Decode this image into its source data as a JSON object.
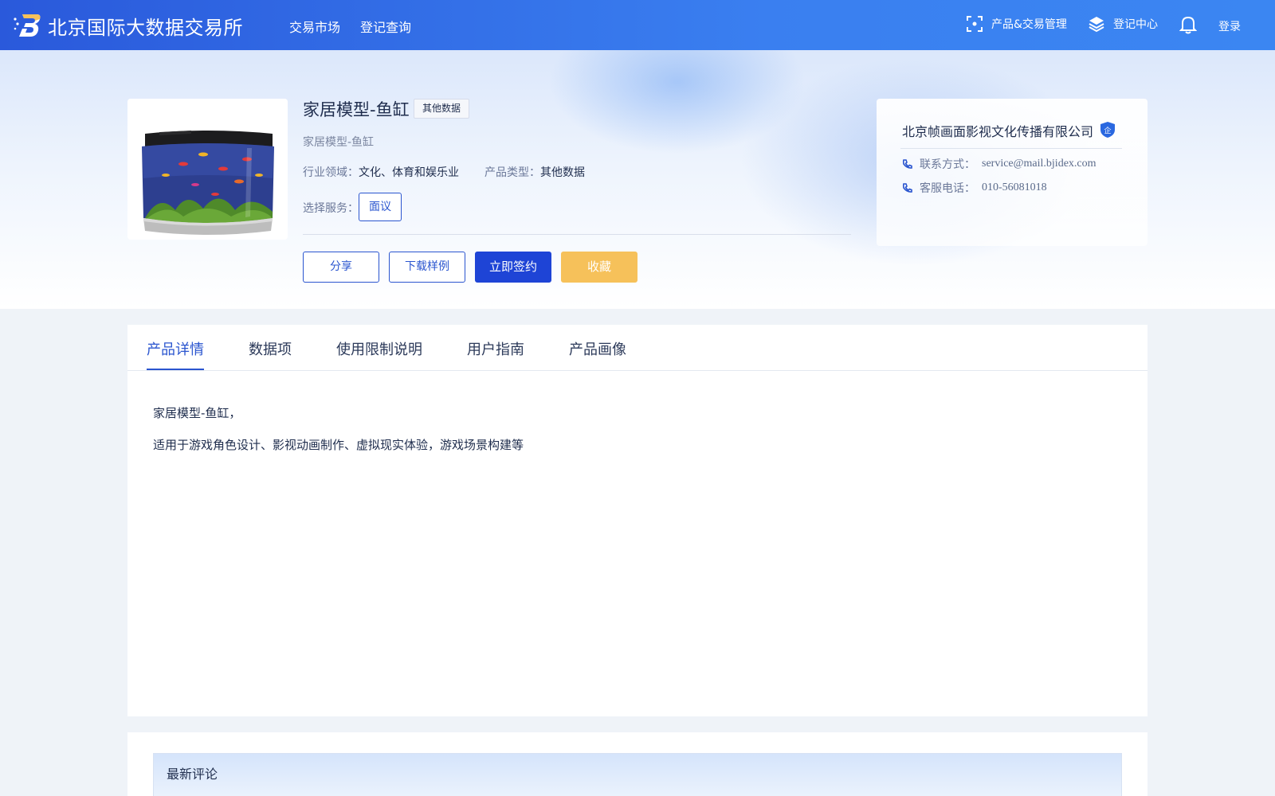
{
  "header": {
    "site_title": "北京国际大数据交易所",
    "nav": {
      "market": "交易市场",
      "query": "登记查询"
    },
    "manage": "产品&交易管理",
    "register_center": "登记中心",
    "login": "登录"
  },
  "product": {
    "title": "家居模型-鱼缸",
    "tag": "其他数据",
    "subtitle": "家居模型-鱼缸",
    "industry_label": "行业领域：",
    "industry_value": "文化、体育和娱乐业",
    "type_label": "产品类型：",
    "type_value": "其他数据",
    "service_label": "选择服务：",
    "service_option": "面议"
  },
  "actions": {
    "share": "分享",
    "download": "下载样例",
    "sign": "立即签约",
    "favorite": "收藏"
  },
  "seller": {
    "name": "北京帧画面影视文化传播有限公司",
    "badge": "企",
    "contact_label": "联系方式：",
    "contact_value": "service@mail.bjidex.com",
    "phone_label": "客服电话：",
    "phone_value": "010-56081018"
  },
  "tabs": [
    "产品详情",
    "数据项",
    "使用限制说明",
    "用户指南",
    "产品画像"
  ],
  "active_tab": 0,
  "detail": {
    "line1": "家居模型-鱼缸，",
    "line2": "适用于游戏角色设计、影视动画制作、虚拟现实体验，游戏场景构建等"
  },
  "comments": {
    "title": "最新评论"
  },
  "colors": {
    "primary": "#2a55cf",
    "sign_button": "#1e44d6",
    "favorite_button": "#f6c15a",
    "header_start": "#2a59db",
    "header_end": "#3b86f2"
  }
}
